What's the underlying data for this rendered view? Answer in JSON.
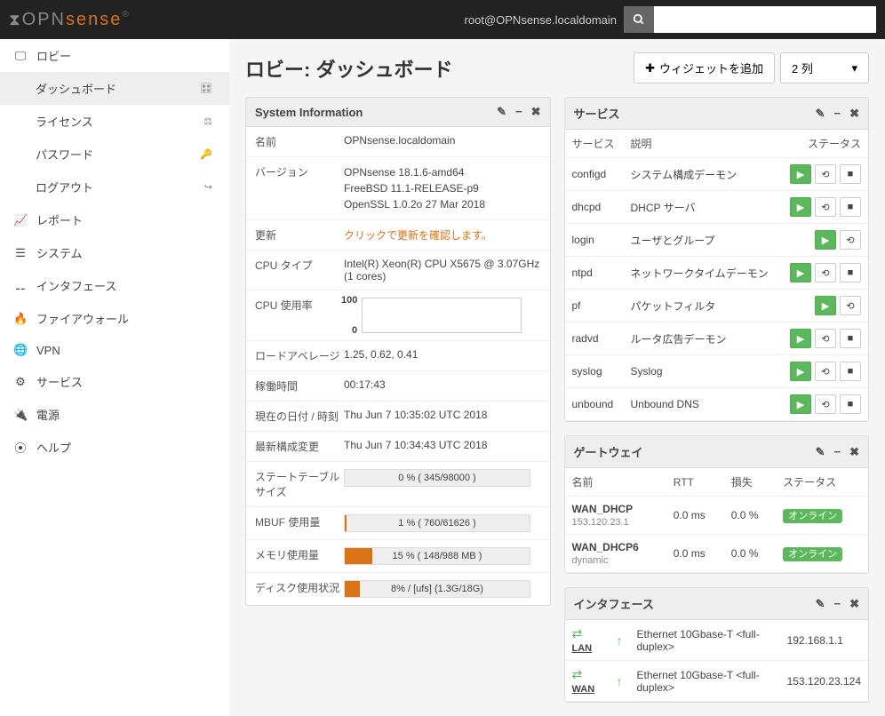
{
  "header": {
    "logo_opn": "OPN",
    "logo_sense": "sense",
    "user": "root@OPNsense.localdomain",
    "search_placeholder": ""
  },
  "sidebar": {
    "lobby": "ロビー",
    "dashboard": "ダッシュボード",
    "license": "ライセンス",
    "password": "パスワード",
    "logout": "ログアウト",
    "report": "レポート",
    "system": "システム",
    "interfaces": "インタフェース",
    "firewall": "ファイアウォール",
    "vpn": "VPN",
    "services": "サービス",
    "power": "電源",
    "help": "ヘルプ"
  },
  "page": {
    "title": "ロビー: ダッシュボード",
    "add_widget": "ウィジェットを追加",
    "columns": "2 列"
  },
  "sysinfo": {
    "title": "System Information",
    "name_label": "名前",
    "name": "OPNsense.localdomain",
    "version_label": "バージョン",
    "version1": "OPNsense 18.1.6-amd64",
    "version2": "FreeBSD 11.1-RELEASE-p9",
    "version3": "OpenSSL 1.0.2o 27 Mar 2018",
    "update_label": "更新",
    "update_link": "クリックで更新を確認します。",
    "cputype_label": "CPU タイプ",
    "cputype": "Intel(R) Xeon(R) CPU X5675 @ 3.07GHz (1 cores)",
    "cpuusage_label": "CPU 使用率",
    "cpu_100": "100",
    "cpu_0": "0",
    "load_label": "ロードアベレージ",
    "load": "1.25, 0.62, 0.41",
    "uptime_label": "稼働時間",
    "uptime": "00:17:43",
    "datetime_label": "現在の日付 / 時刻",
    "datetime": "Thu Jun 7 10:35:02 UTC 2018",
    "lastconfig_label": "最新構成変更",
    "lastconfig": "Thu Jun 7 10:34:43 UTC 2018",
    "state_label": "ステートテーブルサイズ",
    "state_text": "0 % ( 345/98000 )",
    "mbuf_label": "MBUF 使用量",
    "mbuf_text": "1 % ( 760/61626 )",
    "mbuf_pct": 1,
    "mem_label": "メモリ使用量",
    "mem_text": "15 % ( 148/988 MB )",
    "mem_pct": 15,
    "disk_label": "ディスク使用状況",
    "disk_text": "8% / [ufs] (1.3G/18G)",
    "disk_pct": 8
  },
  "services": {
    "title": "サービス",
    "col_service": "サービス",
    "col_desc": "説明",
    "col_status": "ステータス",
    "rows": [
      {
        "name": "configd",
        "desc": "システム構成デーモン",
        "stop": true
      },
      {
        "name": "dhcpd",
        "desc": "DHCP サーバ",
        "stop": true
      },
      {
        "name": "login",
        "desc": "ユーザとグループ",
        "stop": false
      },
      {
        "name": "ntpd",
        "desc": "ネットワークタイムデーモン",
        "stop": true
      },
      {
        "name": "pf",
        "desc": "パケットフィルタ",
        "stop": false
      },
      {
        "name": "radvd",
        "desc": "ルータ広告デーモン",
        "stop": true
      },
      {
        "name": "syslog",
        "desc": "Syslog",
        "stop": true
      },
      {
        "name": "unbound",
        "desc": "Unbound DNS",
        "stop": true
      }
    ]
  },
  "gateways": {
    "title": "ゲートウェイ",
    "col_name": "名前",
    "col_rtt": "RTT",
    "col_loss": "損失",
    "col_status": "ステータス",
    "online": "オンライン",
    "rows": [
      {
        "name": "WAN_DHCP",
        "sub": "153.120.23.1",
        "rtt": "0.0 ms",
        "loss": "0.0 %"
      },
      {
        "name": "WAN_DHCP6",
        "sub": "dynamic",
        "rtt": "0.0 ms",
        "loss": "0.0 %"
      }
    ]
  },
  "interfaces": {
    "title": "インタフェース",
    "rows": [
      {
        "name": "LAN",
        "desc": "Ethernet 10Gbase-T <full-duplex>",
        "ip": "192.168.1.1"
      },
      {
        "name": "WAN",
        "desc": "Ethernet 10Gbase-T <full-duplex>",
        "ip": "153.120.23.124"
      }
    ]
  }
}
